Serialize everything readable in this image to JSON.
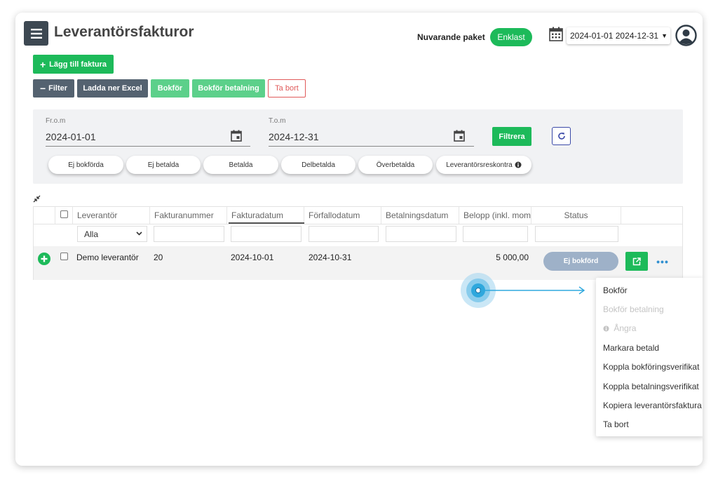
{
  "header": {
    "title": "Leverantörsfakturor",
    "package_label": "Nuvarande paket",
    "package_value": "Enklast",
    "date_range": "2024-01-01 2024-12-31"
  },
  "toolbar": {
    "add_invoice": "Lägg till faktura",
    "filter": "Filter",
    "download_excel": "Ladda ner Excel",
    "book": "Bokför",
    "book_payment": "Bokför betalning",
    "delete": "Ta bort"
  },
  "filter_panel": {
    "from_label": "Fr.o.m",
    "from_value": "2024-01-01",
    "to_label": "T.o.m",
    "to_value": "2024-12-31",
    "filter_button": "Filtrera",
    "chips": [
      "Ej bokförda",
      "Ej betalda",
      "Betalda",
      "Delbetalda",
      "Överbetalda",
      "Leverantörsreskontra"
    ]
  },
  "table": {
    "columns": [
      "Leverantör",
      "Fakturanummer",
      "Fakturadatum",
      "Förfallodatum",
      "Betalningsdatum",
      "Belopp (inkl. moms)",
      "Status"
    ],
    "supplier_filter": "Alla",
    "rows": [
      {
        "supplier": "Demo leverantör",
        "invoice_number": "20",
        "invoice_date": "2024-10-01",
        "due_date": "2024-10-31",
        "payment_date": "",
        "amount": "5 000,00",
        "status": "Ej bokförd"
      }
    ]
  },
  "context_menu": {
    "items": [
      {
        "label": "Bokför",
        "disabled": false
      },
      {
        "label": "Bokför betalning",
        "disabled": true
      },
      {
        "label": "Ångra",
        "disabled": true
      },
      {
        "label": "Markara betald",
        "disabled": false
      },
      {
        "label": "Koppla bokföringsverifikat",
        "disabled": false
      },
      {
        "label": "Koppla betalningsverifikat",
        "disabled": false
      },
      {
        "label": "Kopiera leverantörsfaktura",
        "disabled": false
      },
      {
        "label": "Ta bort",
        "disabled": false
      }
    ]
  },
  "colors": {
    "accent_green": "#1dba5a",
    "dark_button": "#546270",
    "status_pill": "#9eb1c8",
    "link_blue": "#2f8fd0"
  },
  "icons": [
    "menu-icon",
    "calendar-icon",
    "user-avatar-icon",
    "plus-icon",
    "minus-icon",
    "refresh-icon",
    "info-icon",
    "external-link-icon",
    "more-icon",
    "collapse-icon",
    "chevron-down-icon"
  ]
}
